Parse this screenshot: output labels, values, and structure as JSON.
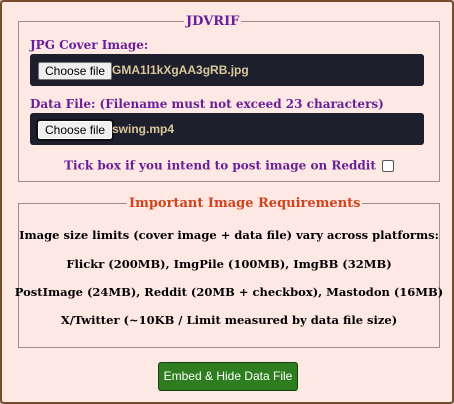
{
  "form": {
    "title": "JDVRIF",
    "cover_label": "JPG Cover Image:",
    "cover_button": "Choose file",
    "cover_filename": "GMA1l1kXgAA3gRB.jpg",
    "data_label": "Data File: (Filename must not exceed 23 characters)",
    "data_button": "Choose file",
    "data_filename": "swing.mp4",
    "reddit_label": "Tick box if you intend to post image on Reddit",
    "reddit_checked": false
  },
  "requirements": {
    "title": "Important Image Requirements",
    "lines": [
      "Image size limits (cover image + data file) vary across platforms:",
      "Flickr (200MB), ImgPile (100MB), ImgBB (32MB)",
      "PostImage (24MB), Reddit (20MB + checkbox), Mastodon (16MB)",
      "X/Twitter (~10KB / Limit measured by data file size)"
    ]
  },
  "actions": {
    "embed_label": "Embed & Hide Data File"
  },
  "colors": {
    "background": "#fde8e4",
    "accent_purple": "#6a1f9a",
    "accent_red": "#d2421c",
    "file_bar": "#1e1f2c",
    "button_green": "#2e7d1f"
  }
}
